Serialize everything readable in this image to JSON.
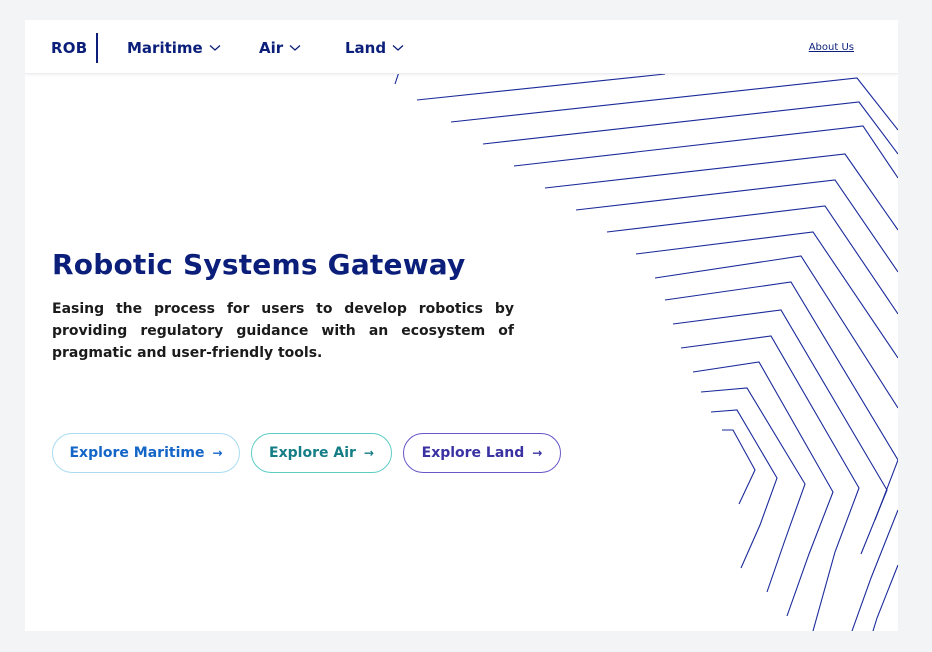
{
  "nav": {
    "logo": "ROB",
    "items": [
      {
        "label": "Maritime"
      },
      {
        "label": "Air"
      },
      {
        "label": "Land"
      }
    ],
    "about": "About Us"
  },
  "hero": {
    "title": "Robotic Systems Gateway",
    "description": "Easing the process for users to develop robotics by providing regulatory guidance with an ecosystem of pragmatic and user-friendly tools."
  },
  "buttons": {
    "maritime": {
      "label": "Explore Maritime",
      "arrow": "→"
    },
    "air": {
      "label": "Explore Air",
      "arrow": "→"
    },
    "land": {
      "label": "Explore Land",
      "arrow": "→"
    }
  },
  "colors": {
    "brand_navy": "#0b1f7a",
    "line_stroke": "#1a2a9a",
    "maritime": "#1465c8",
    "air": "#157d86",
    "land": "#3a32a3"
  }
}
